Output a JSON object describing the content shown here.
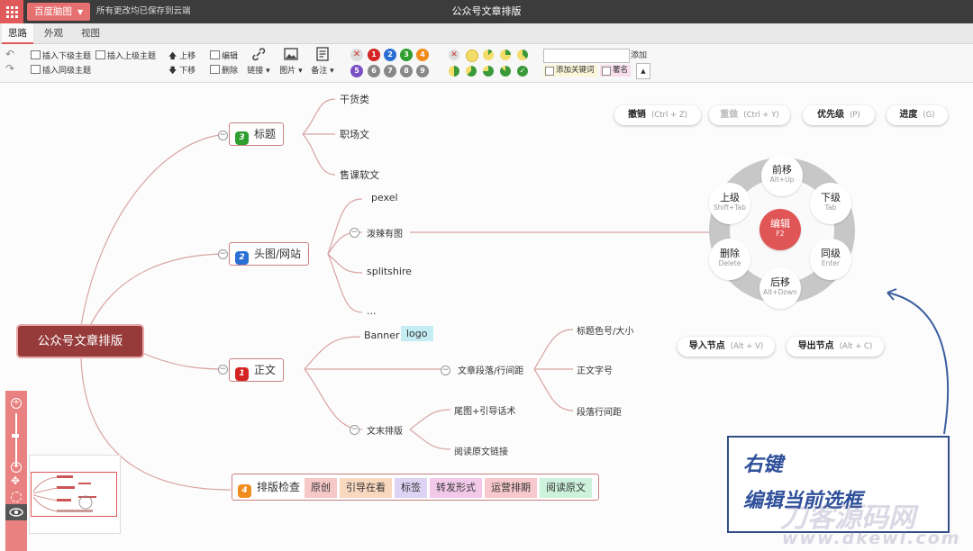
{
  "app": {
    "brand": "百度脑图",
    "save_status": "所有更改均已保存到云端",
    "doc_title": "公众号文章排版"
  },
  "tabs": [
    "思路",
    "外观",
    "视图"
  ],
  "toolbar": {
    "insert_child": "插入下级主题",
    "insert_parent": "插入上级主题",
    "insert_sibling": "插入同级主题",
    "move_up": "上移",
    "move_down": "下移",
    "edit": "编辑",
    "delete": "删除",
    "link": "链接",
    "image": "图片",
    "note": "备注",
    "priorities": [
      "1",
      "2",
      "3",
      "4",
      "5",
      "6",
      "7",
      "8",
      "9"
    ],
    "keyword_add": "添加",
    "add_keyword": "添加关键词",
    "signature": "署名"
  },
  "mindmap": {
    "root": "公众号文章排版",
    "topics": {
      "title": {
        "num": "3",
        "label": "标题",
        "children": [
          "干货类",
          "职场文",
          "售课软文"
        ]
      },
      "header": {
        "num": "2",
        "label": "头图/网站",
        "children": [
          "pexel",
          "泼辣有图",
          "splitshire",
          "..."
        ]
      },
      "body": {
        "num": "1",
        "label": "正文",
        "banner": "Banner",
        "logo": "logo",
        "para": "文章段落/行间距",
        "para_children": [
          "标题色号/大小",
          "正文字号",
          "段落行间距"
        ],
        "end": "文末排版",
        "end_children": [
          "尾图+引导话术",
          "阅读原文链接"
        ]
      },
      "check": {
        "num": "4",
        "label": "排版检查",
        "tags": [
          "原创",
          "引导在看",
          "标签",
          "转发形式",
          "运营排期",
          "阅读原文"
        ]
      }
    }
  },
  "shortcuts": {
    "undo": {
      "label": "撤销",
      "key": "(Ctrl + Z)"
    },
    "redo": {
      "label": "重做",
      "key": "(Ctrl + Y)"
    },
    "priority": {
      "label": "优先级",
      "key": "(P)"
    },
    "progress": {
      "label": "进度",
      "key": "(G)"
    },
    "import": {
      "label": "导入节点",
      "key": "(Alt + V)"
    },
    "export": {
      "label": "导出节点",
      "key": "(Alt + C)"
    }
  },
  "radial_menu": {
    "center": {
      "label": "编辑",
      "key": "F2"
    },
    "forward": {
      "label": "前移",
      "key": "Alt+Up"
    },
    "child": {
      "label": "下级",
      "key": "Tab"
    },
    "sibling": {
      "label": "同级",
      "key": "Enter"
    },
    "backward": {
      "label": "后移",
      "key": "Alt+Down"
    },
    "remove": {
      "label": "删除",
      "key": "Delete"
    },
    "parent": {
      "label": "上级",
      "key": "Shift+Tab"
    }
  },
  "callout": {
    "line1": "右键",
    "line2": "编辑当前选框"
  },
  "watermark": {
    "line1": "刀客源码网",
    "line2": "www.dkewl.com"
  },
  "colors": {
    "accent": "#e05a5a",
    "root": "#963a3a",
    "link": "#d99a9a",
    "badge1": "#d42424",
    "badge2": "#2a6fd4",
    "badge3": "#2e9e2e",
    "badge4": "#f08c1c",
    "callout": "#2e4f9a"
  }
}
